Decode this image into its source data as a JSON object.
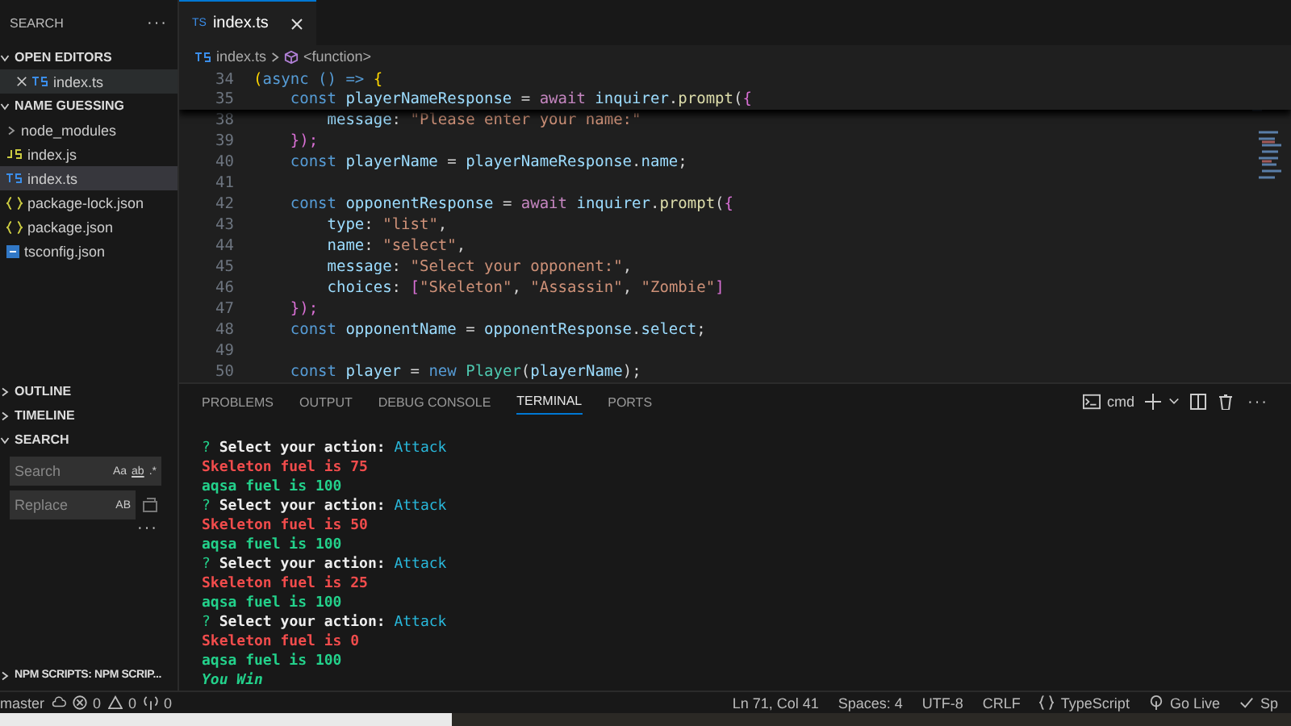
{
  "sidebar": {
    "title": "SEARCH",
    "more": "···",
    "sections": [
      {
        "label": "OPEN EDITORS",
        "expanded": true,
        "items": [
          {
            "name": "index.ts",
            "kind": "ts",
            "selected": false,
            "closable": true
          }
        ]
      },
      {
        "label": "NAME GUESSING",
        "expanded": true,
        "items": [
          {
            "name": "node_modules",
            "kind": "folder",
            "selected": false,
            "closable": false
          },
          {
            "name": "index.js",
            "kind": "js",
            "selected": false,
            "closable": false
          },
          {
            "name": "index.ts",
            "kind": "ts",
            "selected": true,
            "closable": false
          },
          {
            "name": "package-lock.json",
            "kind": "json",
            "selected": false,
            "closable": false
          },
          {
            "name": "package.json",
            "kind": "json",
            "selected": false,
            "closable": false
          },
          {
            "name": "tsconfig.json",
            "kind": "config",
            "selected": false,
            "closable": false
          }
        ]
      }
    ],
    "lower_sections": [
      {
        "label": "OUTLINE",
        "expanded": false
      },
      {
        "label": "TIMELINE",
        "expanded": false
      },
      {
        "label": "SEARCH",
        "expanded": true
      }
    ],
    "search": {
      "placeholder": "Search",
      "options": [
        "Aa",
        "ab",
        ".*"
      ]
    },
    "replace": {
      "placeholder": "Replace",
      "option": "AB"
    },
    "search_more": "···",
    "npm_scripts": {
      "label": "NPM SCRIPTS: NPM SCRIP...",
      "expanded": false
    }
  },
  "editor": {
    "tabs": [
      {
        "label": "index.ts",
        "icon": "TS",
        "selected": true
      }
    ],
    "breadcrumb": [
      {
        "label": "index.ts",
        "kind": "ts"
      },
      {
        "label": "<function>",
        "kind": "symbol"
      }
    ],
    "sticky_lines": [
      {
        "number": "34",
        "tokens": [
          {
            "text": "(",
            "kind": "brace"
          },
          {
            "text": "async () => ",
            "kind": "kw"
          },
          {
            "text": "{",
            "kind": "brace"
          }
        ]
      },
      {
        "number": "35",
        "tokens": [
          {
            "text": "    const ",
            "kind": "kw"
          },
          {
            "text": "playerNameResponse",
            "kind": "var"
          },
          {
            "text": " = ",
            "kind": "plain"
          },
          {
            "text": "await ",
            "kind": "ctl"
          },
          {
            "text": "inquirer",
            "kind": "var"
          },
          {
            "text": ".",
            "kind": "plain"
          },
          {
            "text": "prompt",
            "kind": "fn"
          },
          {
            "text": "(",
            "kind": "plain"
          },
          {
            "text": "{",
            "kind": "brace2"
          }
        ]
      }
    ],
    "lines": [
      {
        "number": "38",
        "tokens": [
          {
            "text": "        message",
            "kind": "var"
          },
          {
            "text": ": ",
            "kind": "plain"
          },
          {
            "text": "\"Please enter your name:\"",
            "kind": "str"
          }
        ]
      },
      {
        "number": "39",
        "tokens": [
          {
            "text": "    });",
            "kind": "brace2"
          }
        ]
      },
      {
        "number": "40",
        "tokens": [
          {
            "text": "    const ",
            "kind": "kw"
          },
          {
            "text": "playerName",
            "kind": "var"
          },
          {
            "text": " = ",
            "kind": "plain"
          },
          {
            "text": "playerNameResponse",
            "kind": "var"
          },
          {
            "text": ".",
            "kind": "plain"
          },
          {
            "text": "name",
            "kind": "var"
          },
          {
            "text": ";",
            "kind": "plain"
          }
        ]
      },
      {
        "number": "41"
      },
      {
        "number": "42",
        "tokens": [
          {
            "text": "    const ",
            "kind": "kw"
          },
          {
            "text": "opponentResponse",
            "kind": "var"
          },
          {
            "text": " = ",
            "kind": "plain"
          },
          {
            "text": "await ",
            "kind": "ctl"
          },
          {
            "text": "inquirer",
            "kind": "var"
          },
          {
            "text": ".",
            "kind": "plain"
          },
          {
            "text": "prompt",
            "kind": "fn"
          },
          {
            "text": "(",
            "kind": "plain"
          },
          {
            "text": "{",
            "kind": "brace2"
          }
        ]
      },
      {
        "number": "43",
        "tokens": [
          {
            "text": "        type",
            "kind": "var"
          },
          {
            "text": ": ",
            "kind": "plain"
          },
          {
            "text": "\"list\"",
            "kind": "str"
          },
          {
            "text": ",",
            "kind": "plain"
          }
        ]
      },
      {
        "number": "44",
        "tokens": [
          {
            "text": "        name",
            "kind": "var"
          },
          {
            "text": ": ",
            "kind": "plain"
          },
          {
            "text": "\"select\"",
            "kind": "str"
          },
          {
            "text": ",",
            "kind": "plain"
          }
        ]
      },
      {
        "number": "45",
        "tokens": [
          {
            "text": "        message",
            "kind": "var"
          },
          {
            "text": ": ",
            "kind": "plain"
          },
          {
            "text": "\"Select your opponent:\"",
            "kind": "str"
          },
          {
            "text": ",",
            "kind": "plain"
          }
        ]
      },
      {
        "number": "46",
        "tokens": [
          {
            "text": "        choices",
            "kind": "var"
          },
          {
            "text": ": ",
            "kind": "plain"
          },
          {
            "text": "[",
            "kind": "brace2"
          },
          {
            "text": "\"Skeleton\"",
            "kind": "str"
          },
          {
            "text": ", ",
            "kind": "plain"
          },
          {
            "text": "\"Assassin\"",
            "kind": "str"
          },
          {
            "text": ", ",
            "kind": "plain"
          },
          {
            "text": "\"Zombie\"",
            "kind": "str"
          },
          {
            "text": "]",
            "kind": "brace2"
          }
        ]
      },
      {
        "number": "47",
        "tokens": [
          {
            "text": "    });",
            "kind": "brace2"
          }
        ]
      },
      {
        "number": "48",
        "tokens": [
          {
            "text": "    const ",
            "kind": "kw"
          },
          {
            "text": "opponentName",
            "kind": "var"
          },
          {
            "text": " = ",
            "kind": "plain"
          },
          {
            "text": "opponentResponse",
            "kind": "var"
          },
          {
            "text": ".",
            "kind": "plain"
          },
          {
            "text": "select",
            "kind": "var"
          },
          {
            "text": ";",
            "kind": "plain"
          }
        ]
      },
      {
        "number": "49"
      },
      {
        "number": "50",
        "tokens": [
          {
            "text": "    const ",
            "kind": "kw"
          },
          {
            "text": "player",
            "kind": "var"
          },
          {
            "text": " = ",
            "kind": "plain"
          },
          {
            "text": "new ",
            "kind": "kw"
          },
          {
            "text": "Player",
            "kind": "cls"
          },
          {
            "text": "(",
            "kind": "plain"
          },
          {
            "text": "playerName",
            "kind": "var"
          },
          {
            "text": ");",
            "kind": "plain"
          }
        ]
      }
    ]
  },
  "panel": {
    "tabs": [
      {
        "label": "PROBLEMS",
        "selected": false
      },
      {
        "label": "OUTPUT",
        "selected": false
      },
      {
        "label": "DEBUG CONSOLE",
        "selected": false
      },
      {
        "label": "TERMINAL",
        "selected": true
      },
      {
        "label": "PORTS",
        "selected": false
      }
    ],
    "terminal_name": "cmd",
    "more": "···",
    "terminal": [
      [
        {
          "text": "? ",
          "kind": "q"
        },
        {
          "text": "Select your action: ",
          "kind": "prompt"
        },
        {
          "text": "Attack",
          "kind": "answer"
        }
      ],
      [
        {
          "text": "Skeleton fuel is 75",
          "kind": "red"
        }
      ],
      [
        {
          "text": "aqsa fuel is 100",
          "kind": "green"
        }
      ],
      [
        {
          "text": "? ",
          "kind": "q"
        },
        {
          "text": "Select your action: ",
          "kind": "prompt"
        },
        {
          "text": "Attack",
          "kind": "answer"
        }
      ],
      [
        {
          "text": "Skeleton fuel is 50",
          "kind": "red"
        }
      ],
      [
        {
          "text": "aqsa fuel is 100",
          "kind": "green"
        }
      ],
      [
        {
          "text": "? ",
          "kind": "q"
        },
        {
          "text": "Select your action: ",
          "kind": "prompt"
        },
        {
          "text": "Attack",
          "kind": "answer"
        }
      ],
      [
        {
          "text": "Skeleton fuel is 25",
          "kind": "red"
        }
      ],
      [
        {
          "text": "aqsa fuel is 100",
          "kind": "green"
        }
      ],
      [
        {
          "text": "? ",
          "kind": "q"
        },
        {
          "text": "Select your action: ",
          "kind": "prompt"
        },
        {
          "text": "Attack",
          "kind": "answer"
        }
      ],
      [
        {
          "text": "Skeleton fuel is 0",
          "kind": "red"
        }
      ],
      [
        {
          "text": "aqsa fuel is 100",
          "kind": "green"
        }
      ],
      [
        {
          "text": "You Win",
          "kind": "win"
        }
      ]
    ]
  },
  "status_bar": {
    "branch": "master",
    "errors": "0",
    "warnings": "0",
    "ports": "0",
    "right": [
      {
        "label": "Ln 71, Col 41",
        "kind": "text"
      },
      {
        "label": "Spaces: 4",
        "kind": "text"
      },
      {
        "label": "UTF-8",
        "kind": "text"
      },
      {
        "label": "CRLF",
        "kind": "text"
      },
      {
        "label": "TypeScript",
        "kind": "language"
      },
      {
        "label": "Go Live",
        "kind": "live"
      },
      {
        "label": "Sp",
        "kind": "check"
      }
    ]
  }
}
